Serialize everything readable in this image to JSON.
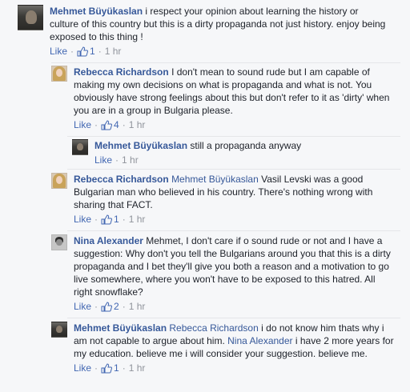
{
  "comments": [
    {
      "author": "Mehmet Büyükaslan",
      "text": "i respect your opinion about learning the history or culture of this country but this is a dirty propaganda not just history. enjoy being exposed to this thing !",
      "like_label": "Like",
      "likes": "1",
      "time": "1 hr"
    },
    {
      "author": "Rebecca Richardson",
      "text": "I don't mean to sound rude but I am capable of making my own decisions on what is propaganda and what is not. You obviously have strong feelings about this but don't refer to it as 'dirty' when you are in a group in Bulgaria please.",
      "like_label": "Like",
      "likes": "4",
      "time": "1 hr"
    },
    {
      "author": "Mehmet Büyükaslan",
      "text": "still a propaganda anyway",
      "like_label": "Like",
      "time": "1 hr"
    },
    {
      "author": "Rebecca Richardson",
      "mention": "Mehmet Büyükaslan",
      "text": "Vasil Levski was a good Bulgarian man who believed in his country. There's nothing wrong with sharing that FACT.",
      "like_label": "Like",
      "likes": "1",
      "time": "1 hr"
    },
    {
      "author": "Nina Alexander",
      "text": "Mehmet, I don't care if o sound rude or not and I have a suggestion: Why don't you tell the Bulgarians around you that this is a dirty propaganda and I bet they'll give you both a reason and a motivation to go live somewhere, where you won't have to be exposed to this hatred. All right snowflake?",
      "like_label": "Like",
      "likes": "2",
      "time": "1 hr"
    },
    {
      "author": "Mehmet Büyükaslan",
      "mention": "Rebecca Richardson",
      "text_a": "i do not know him thats why i am not capable to argue about him.",
      "mention_b": "Nina Alexander",
      "text_b": "i have 2 more years for my education. believe me i will consider your suggestion. believe me.",
      "like_label": "Like",
      "likes": "1",
      "time": "1 hr"
    }
  ],
  "colors": {
    "link": "#365899",
    "meta": "#90949c",
    "like": "#4267b2",
    "background": "#f6f7f9"
  },
  "icons": {
    "like_count": "thumbs-up-icon"
  }
}
